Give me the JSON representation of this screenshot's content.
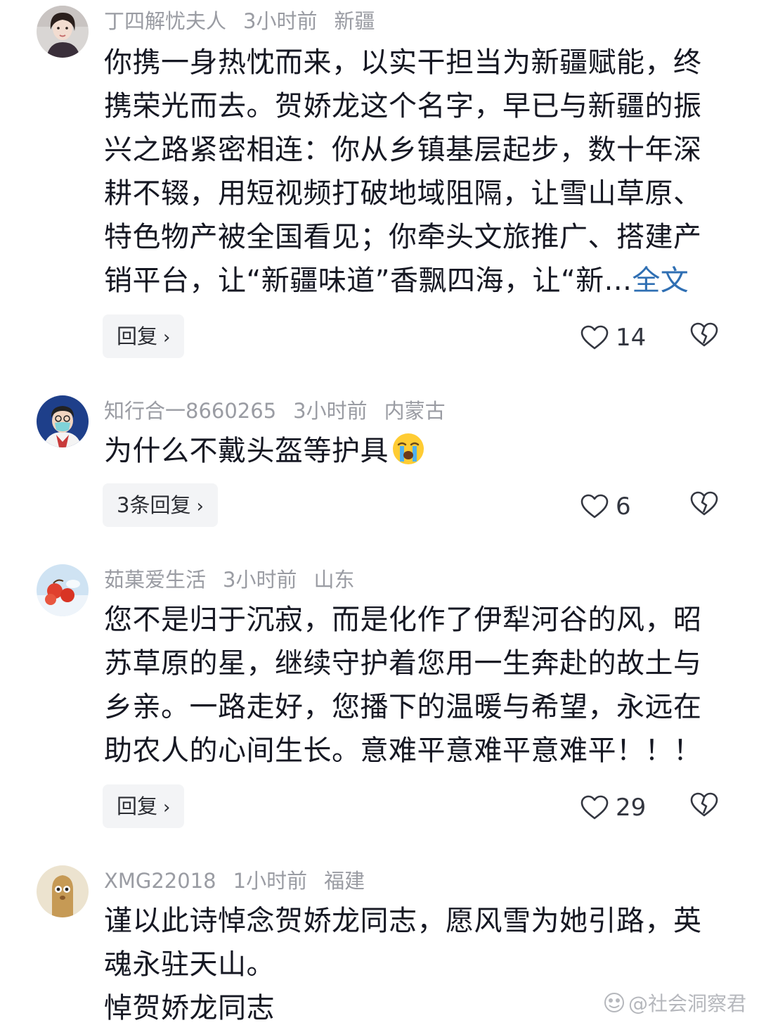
{
  "comments": [
    {
      "username": "丁四解忧夫人",
      "time": "3小时前",
      "location": "新疆",
      "lines": [
        "你携一身热忱而来，以实干担当为新疆赋能，终",
        "携荣光而去。贺娇龙这个名字，早已与新疆的振",
        "兴之路紧密相连：你从乡镇基层起步，数十年深",
        "耕不辍，用短视频打破地域阻隔，让雪山草原、",
        "特色物产被全国看见；你牵头文旅推广、搭建产",
        "销平台，让“新疆味道”香飘四海，让“新..."
      ],
      "more_label": "全文",
      "reply_label": "回复",
      "likes": "14"
    },
    {
      "username": "知行合一8660265",
      "time": "3小时前",
      "location": "内蒙古",
      "lines": [
        "为什么不戴头盔等护具"
      ],
      "emoji": "crying-face",
      "reply_label": "3条回复",
      "likes": "6"
    },
    {
      "username": "茹菓爱生活",
      "time": "3小时前",
      "location": "山东",
      "lines": [
        "您不是归于沉寂，而是化作了伊犁河谷的风，昭",
        "苏草原的星，继续守护着您用一生奔赴的故土与",
        "乡亲。一路走好，您播下的温暖与希望，永远在",
        "助农人的心间生长。意难平意难平意难平！！！"
      ],
      "reply_label": "回复",
      "likes": "29"
    },
    {
      "username": "XMG22018",
      "time": "1小时前",
      "location": "福建",
      "lines": [
        "谨以此诗悼念贺娇龙同志，愿风雪为她引路，英",
        "魂永驻天山。",
        "悼贺娇龙同志"
      ]
    }
  ],
  "watermark": "@社会洞察君",
  "icons": {
    "like": "heart-outline-icon",
    "dislike": "broken-heart-icon",
    "chevron": "chevron-right-icon"
  },
  "colors": {
    "text": "#161823",
    "meta": "#9a9ca3",
    "link": "#2f6fb3",
    "reply_bg": "#f3f4f6"
  }
}
